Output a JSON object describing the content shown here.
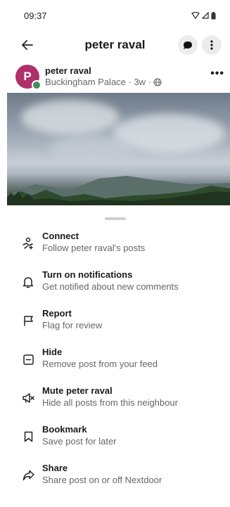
{
  "status_bar": {
    "time": "09:37"
  },
  "header": {
    "title": "peter raval"
  },
  "post": {
    "avatar_letter": "P",
    "author": "peter raval",
    "meta": "Buckingham Palace · 3w ·",
    "more": "•••"
  },
  "menu": {
    "items": [
      {
        "title": "Connect",
        "subtitle": "Follow peter raval's posts",
        "icon": "connect-icon"
      },
      {
        "title": "Turn on notifications",
        "subtitle": "Get notified about new comments",
        "icon": "bell-icon"
      },
      {
        "title": "Report",
        "subtitle": "Flag for review",
        "icon": "flag-icon"
      },
      {
        "title": "Hide",
        "subtitle": "Remove post from your feed",
        "icon": "hide-icon"
      },
      {
        "title": "Mute peter raval",
        "subtitle": "Hide all posts from this neighbour",
        "icon": "mute-icon"
      },
      {
        "title": "Bookmark",
        "subtitle": "Save post for later",
        "icon": "bookmark-icon"
      },
      {
        "title": "Share",
        "subtitle": "Share post on or off Nextdoor",
        "icon": "share-icon"
      }
    ]
  }
}
